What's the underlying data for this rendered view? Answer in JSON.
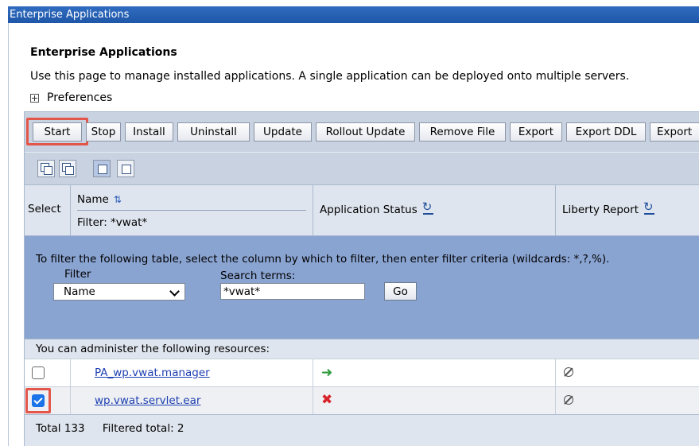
{
  "title_bar": "Enterprise Applications",
  "heading": "Enterprise Applications",
  "description": "Use this page to manage installed applications. A single application can be deployed onto multiple servers.",
  "preferences_label": "Preferences",
  "toolbar": {
    "buttons": [
      "Start",
      "Stop",
      "Install",
      "Uninstall",
      "Update",
      "Rollout Update",
      "Remove File",
      "Export",
      "Export DDL",
      "Export"
    ]
  },
  "icon_buttons": [
    "select-all-icon",
    "deselect-all-icon",
    "show-filter-icon",
    "clear-filter-icon"
  ],
  "table": {
    "headers": {
      "select": "Select",
      "name": "Name",
      "name_filter": "Filter: *vwat*",
      "status": "Application Status",
      "liberty": "Liberty Report"
    }
  },
  "filter": {
    "instructions": "To filter the following table, select the column by which to filter, then enter filter criteria (wildcards: *,?,%).",
    "filter_label": "Filter",
    "filter_value": "Name",
    "search_label": "Search terms:",
    "search_value": "*vwat*",
    "go_label": "Go"
  },
  "admin_text": "You can administer the following resources:",
  "rows": [
    {
      "name": "PA_wp.vwat.manager",
      "checked": false,
      "status": "started"
    },
    {
      "name": "wp.vwat.servlet.ear",
      "checked": true,
      "status": "stopped"
    }
  ],
  "footer": {
    "total": "Total 133",
    "filtered": "Filtered total: 2"
  },
  "colors": {
    "title_bar": "#2f6cc0",
    "filter_bg": "#8aa4d2",
    "highlight": "#e4564a",
    "started": "#2e9b3c",
    "stopped": "#d8232a"
  }
}
